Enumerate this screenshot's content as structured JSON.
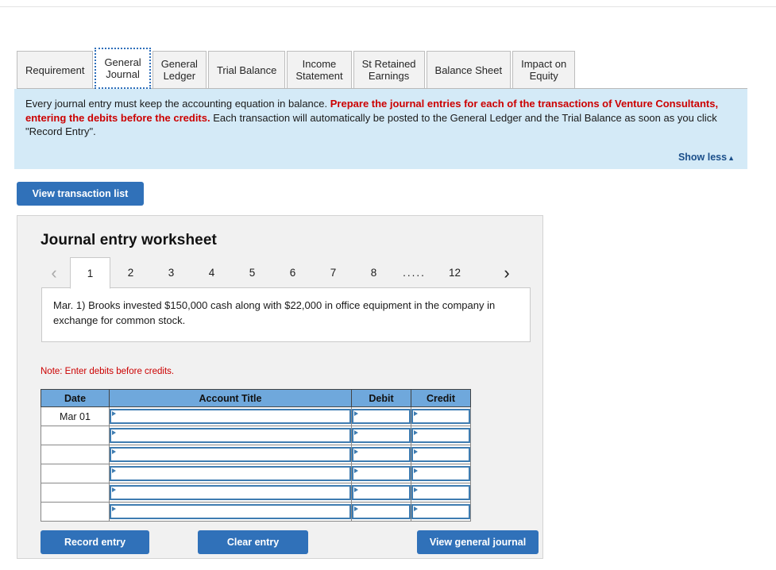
{
  "tabs": [
    {
      "label": "Requirement",
      "active": false
    },
    {
      "label": "General\nJournal",
      "active": true
    },
    {
      "label": "General\nLedger",
      "active": false
    },
    {
      "label": "Trial Balance",
      "active": false
    },
    {
      "label": "Income\nStatement",
      "active": false
    },
    {
      "label": "St Retained\nEarnings",
      "active": false
    },
    {
      "label": "Balance Sheet",
      "active": false
    },
    {
      "label": "Impact on\nEquity",
      "active": false
    }
  ],
  "banner": {
    "lead": "Every journal entry must keep the accounting equation in balance. ",
    "emphasis": "Prepare the journal entries for each of the transactions of Venture Consultants, entering the debits before the credits.",
    "tail": " Each transaction will automatically be posted to the General Ledger and the Trial Balance as soon as you click \"Record Entry\".",
    "show_less_label": "Show less",
    "show_less_caret": "▲",
    "background_color": "#d4eaf7"
  },
  "toolbar": {
    "view_transaction_list_label": "View transaction list"
  },
  "worksheet": {
    "title": "Journal entry worksheet",
    "pager": {
      "prev_icon": "‹",
      "next_icon": "›",
      "pages": [
        "1",
        "2",
        "3",
        "4",
        "5",
        "6",
        "7",
        "8"
      ],
      "ellipsis": ".....",
      "last_page": "12",
      "active_page": "1"
    },
    "transaction_text": "Mar. 1) Brooks invested $150,000 cash along with $22,000 in office equipment in the company in exchange for common stock.",
    "note": "Note: Enter debits before credits.",
    "table": {
      "headers": [
        "Date",
        "Account Title",
        "Debit",
        "Credit"
      ],
      "rows": [
        {
          "date": "Mar 01",
          "account_title": "",
          "debit": "",
          "credit": ""
        },
        {
          "date": "",
          "account_title": "",
          "debit": "",
          "credit": ""
        },
        {
          "date": "",
          "account_title": "",
          "debit": "",
          "credit": ""
        },
        {
          "date": "",
          "account_title": "",
          "debit": "",
          "credit": ""
        },
        {
          "date": "",
          "account_title": "",
          "debit": "",
          "credit": ""
        },
        {
          "date": "",
          "account_title": "",
          "debit": "",
          "credit": ""
        }
      ],
      "header_color": "#6fa8dc"
    },
    "buttons": {
      "record_entry": "Record entry",
      "clear_entry": "Clear entry",
      "view_general_journal": "View general journal"
    }
  },
  "theme": {
    "button_blue": "#3071b9",
    "note_red": "#cc0000",
    "link_navy": "#1b4f8a"
  }
}
